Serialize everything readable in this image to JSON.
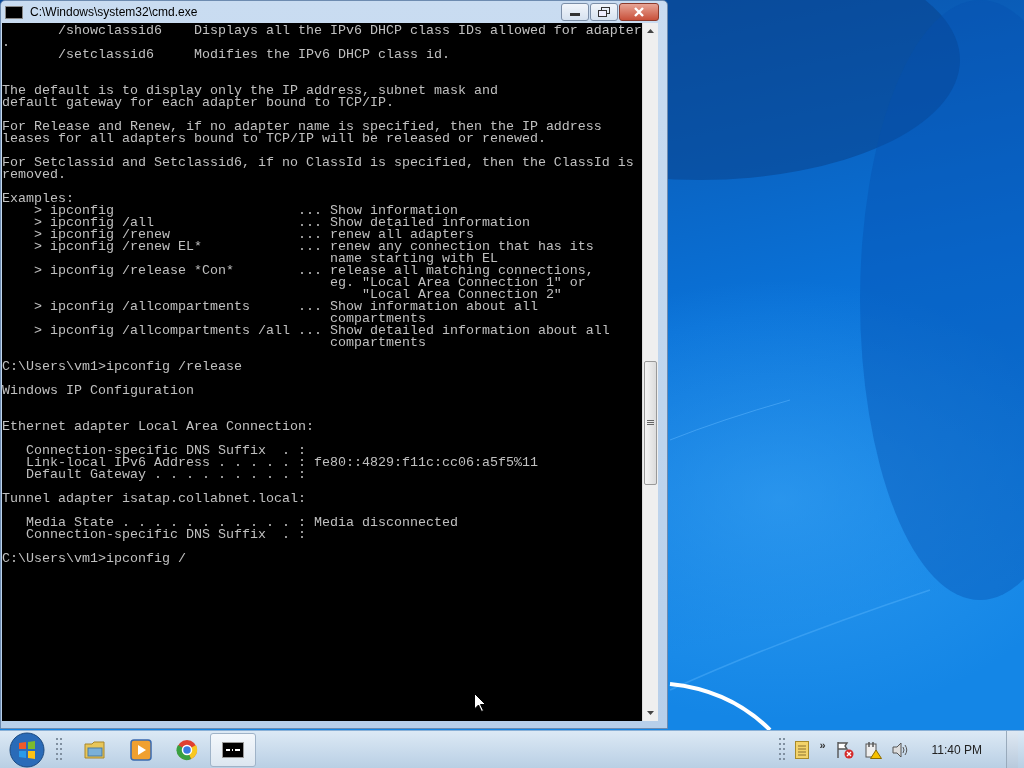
{
  "window": {
    "title": "C:\\Windows\\system32\\cmd.exe"
  },
  "console": {
    "lines": [
      {
        "kind": "text",
        "text": "       /showclassid6    Displays all the IPv6 DHCP class IDs allowed for adapter"
      },
      {
        "kind": "text",
        "text": "."
      },
      {
        "kind": "text",
        "text": "       /setclassid6     Modifies the IPv6 DHCP class id."
      },
      {
        "kind": "blank"
      },
      {
        "kind": "blank"
      },
      {
        "kind": "text",
        "text": "The default is to display only the IP address, subnet mask and"
      },
      {
        "kind": "text",
        "text": "default gateway for each adapter bound to TCP/IP."
      },
      {
        "kind": "blank"
      },
      {
        "kind": "text",
        "text": "For Release and Renew, if no adapter name is specified, then the IP address"
      },
      {
        "kind": "text",
        "text": "leases for all adapters bound to TCP/IP will be released or renewed."
      },
      {
        "kind": "blank"
      },
      {
        "kind": "text",
        "text": "For Setclassid and Setclassid6, if no ClassId is specified, then the ClassId is"
      },
      {
        "kind": "text",
        "text": "removed."
      },
      {
        "kind": "blank"
      },
      {
        "kind": "text",
        "text": "Examples:"
      },
      {
        "kind": "text",
        "text": "    > ipconfig                       ... Show information"
      },
      {
        "kind": "text",
        "text": "    > ipconfig /all                  ... Show detailed information"
      },
      {
        "kind": "text",
        "text": "    > ipconfig /renew                ... renew all adapters"
      },
      {
        "kind": "text",
        "text": "    > ipconfig /renew EL*            ... renew any connection that has its"
      },
      {
        "kind": "text",
        "text": "                                         name starting with EL"
      },
      {
        "kind": "text",
        "text": "    > ipconfig /release *Con*        ... release all matching connections,"
      },
      {
        "kind": "text",
        "text": "                                         eg. \"Local Area Connection 1\" or"
      },
      {
        "kind": "text",
        "text": "                                             \"Local Area Connection 2\""
      },
      {
        "kind": "text",
        "text": "    > ipconfig /allcompartments      ... Show information about all"
      },
      {
        "kind": "text",
        "text": "                                         compartments"
      },
      {
        "kind": "text",
        "text": "    > ipconfig /allcompartments /all ... Show detailed information about all"
      },
      {
        "kind": "text",
        "text": "                                         compartments"
      },
      {
        "kind": "blank"
      },
      {
        "kind": "text",
        "text": "C:\\Users\\vm1>ipconfig /release"
      },
      {
        "kind": "blank"
      },
      {
        "kind": "text",
        "text": "Windows IP Configuration"
      },
      {
        "kind": "blank"
      },
      {
        "kind": "blank"
      },
      {
        "kind": "text",
        "text": "Ethernet adapter Local Area Connection:"
      },
      {
        "kind": "blank"
      },
      {
        "kind": "text",
        "text": "   Connection-specific DNS Suffix  . :"
      },
      {
        "kind": "text",
        "text": "   Link-local IPv6 Address . . . . . : fe80::4829:f11c:cc06:a5f5%11"
      },
      {
        "kind": "text",
        "text": "   Default Gateway . . . . . . . . . :"
      },
      {
        "kind": "blank"
      },
      {
        "kind": "text",
        "text": "Tunnel adapter isatap.collabnet.local:"
      },
      {
        "kind": "blank"
      },
      {
        "kind": "text",
        "text": "   Media State . . . . . . . . . . . : Media disconnected"
      },
      {
        "kind": "text",
        "text": "   Connection-specific DNS Suffix  . :"
      },
      {
        "kind": "blank"
      },
      {
        "kind": "text",
        "text": "C:\\Users\\vm1>ipconfig /"
      }
    ]
  },
  "taskbar": {
    "items": [
      {
        "kind": "folder",
        "selected": false
      },
      {
        "kind": "media",
        "selected": false
      },
      {
        "kind": "browser",
        "selected": false
      },
      {
        "kind": "console",
        "selected": true
      }
    ]
  },
  "tray": {
    "chevron": "»",
    "clock": "11:40 PM"
  }
}
